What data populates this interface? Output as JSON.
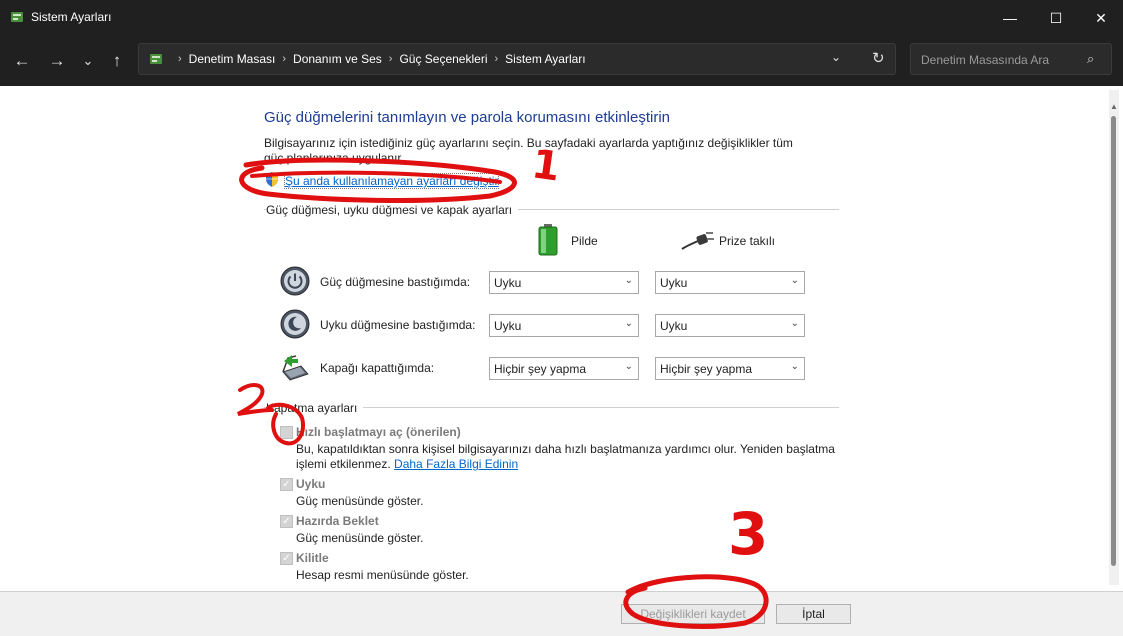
{
  "window": {
    "title": "Sistem Ayarları",
    "minimize_glyph": "—",
    "maximize_glyph": "☐",
    "close_glyph": "✕"
  },
  "nav": {
    "back_glyph": "←",
    "forward_glyph": "→",
    "recent_glyph": "⌄",
    "up_glyph": "↑"
  },
  "address": {
    "crumbs": [
      "Denetim Masası",
      "Donanım ve Ses",
      "Güç Seçenekleri",
      "Sistem Ayarları"
    ],
    "separator": "›",
    "dropdown_glyph": "⌄",
    "refresh_glyph": "↻"
  },
  "search": {
    "placeholder": "Denetim Masasında Ara",
    "value": ""
  },
  "main": {
    "heading": "Güç düğmelerini tanımlayın ve parola korumasını etkinleştirin",
    "description": "Bilgisayarınız için istediğiniz güç ayarlarını seçin. Bu sayfadaki ayarlarda yaptığınız değişiklikler tüm güç planlarınıza uygulanır.",
    "change_link": "Şu anda kullanılamayan ayarları değiştir"
  },
  "power_buttons": {
    "group_title": "Güç düğmesi, uyku düğmesi ve kapak ayarları",
    "col_battery": "Pilde",
    "col_plugged": "Prize takılı",
    "rows": [
      {
        "label": "Güç düğmesine bastığımda:",
        "battery": "Uyku",
        "plugged": "Uyku"
      },
      {
        "label": "Uyku düğmesine bastığımda:",
        "battery": "Uyku",
        "plugged": "Uyku"
      },
      {
        "label": "Kapağı kapattığımda:",
        "battery": "Hiçbir şey yapma",
        "plugged": "Hiçbir şey yapma"
      }
    ]
  },
  "shutdown": {
    "group_title": "Kapatma ayarları",
    "fast_startup_label": "Hızlı başlatmayı aç (önerilen)",
    "fast_startup_desc": "Bu, kapatıldıktan sonra kişisel bilgisayarınızı daha hızlı başlatmanıza yardımcı olur. Yeniden başlatma işlemi etkilenmez.",
    "fast_startup_link": "Daha Fazla Bilgi Edinin",
    "options": [
      {
        "label": "Uyku",
        "desc": "Güç menüsünde göster.",
        "checked": true
      },
      {
        "label": "Hazırda Beklet",
        "desc": "Güç menüsünde göster.",
        "checked": true
      },
      {
        "label": "Kilitle",
        "desc": "Hesap resmi menüsünde göster.",
        "checked": true
      }
    ]
  },
  "footer": {
    "save_label": "Değişiklikleri kaydet",
    "cancel_label": "İptal"
  },
  "annotations": {
    "num1": "1",
    "num2": "2",
    "num3": "3",
    "color": "#e01010"
  }
}
